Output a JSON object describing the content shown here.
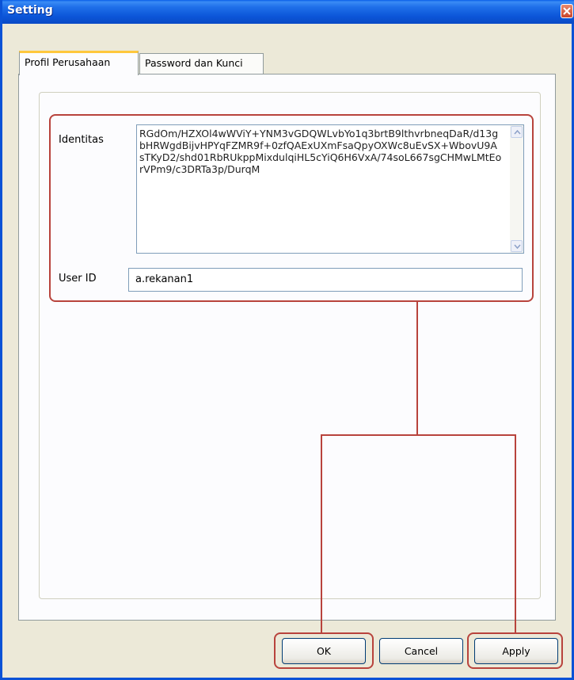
{
  "window": {
    "title": "Setting"
  },
  "tabs": [
    {
      "label": "Profil Perusahaan",
      "active": true
    },
    {
      "label": "Password dan Kunci",
      "active": false
    }
  ],
  "form": {
    "identitas_label": "Identitas",
    "identitas_value": "RGdOm/HZXOl4wWViY+YNM3vGDQWLvbYo1q3brtB9lthvrbneqDaR/d13gbHRWgdBijvHPYqFZMR9f+0zfQAExUXmFsaQpyOXWc8uEvSX+WbovU9AsTKyD2/shd01RbRUkppMixdulqiHL5cYiQ6H6VxA/74soL667sgCHMwLMtEorVPm9/c3DRTa3p/DurqM",
    "userid_label": "User ID",
    "userid_value": "a.rekanan1"
  },
  "buttons": {
    "ok": "OK",
    "cancel": "Cancel",
    "apply": "Apply"
  },
  "colors": {
    "annotation": "#b8433c",
    "titlebar": "#0a5fe8",
    "active_tab_highlight": "#ffc83c"
  }
}
